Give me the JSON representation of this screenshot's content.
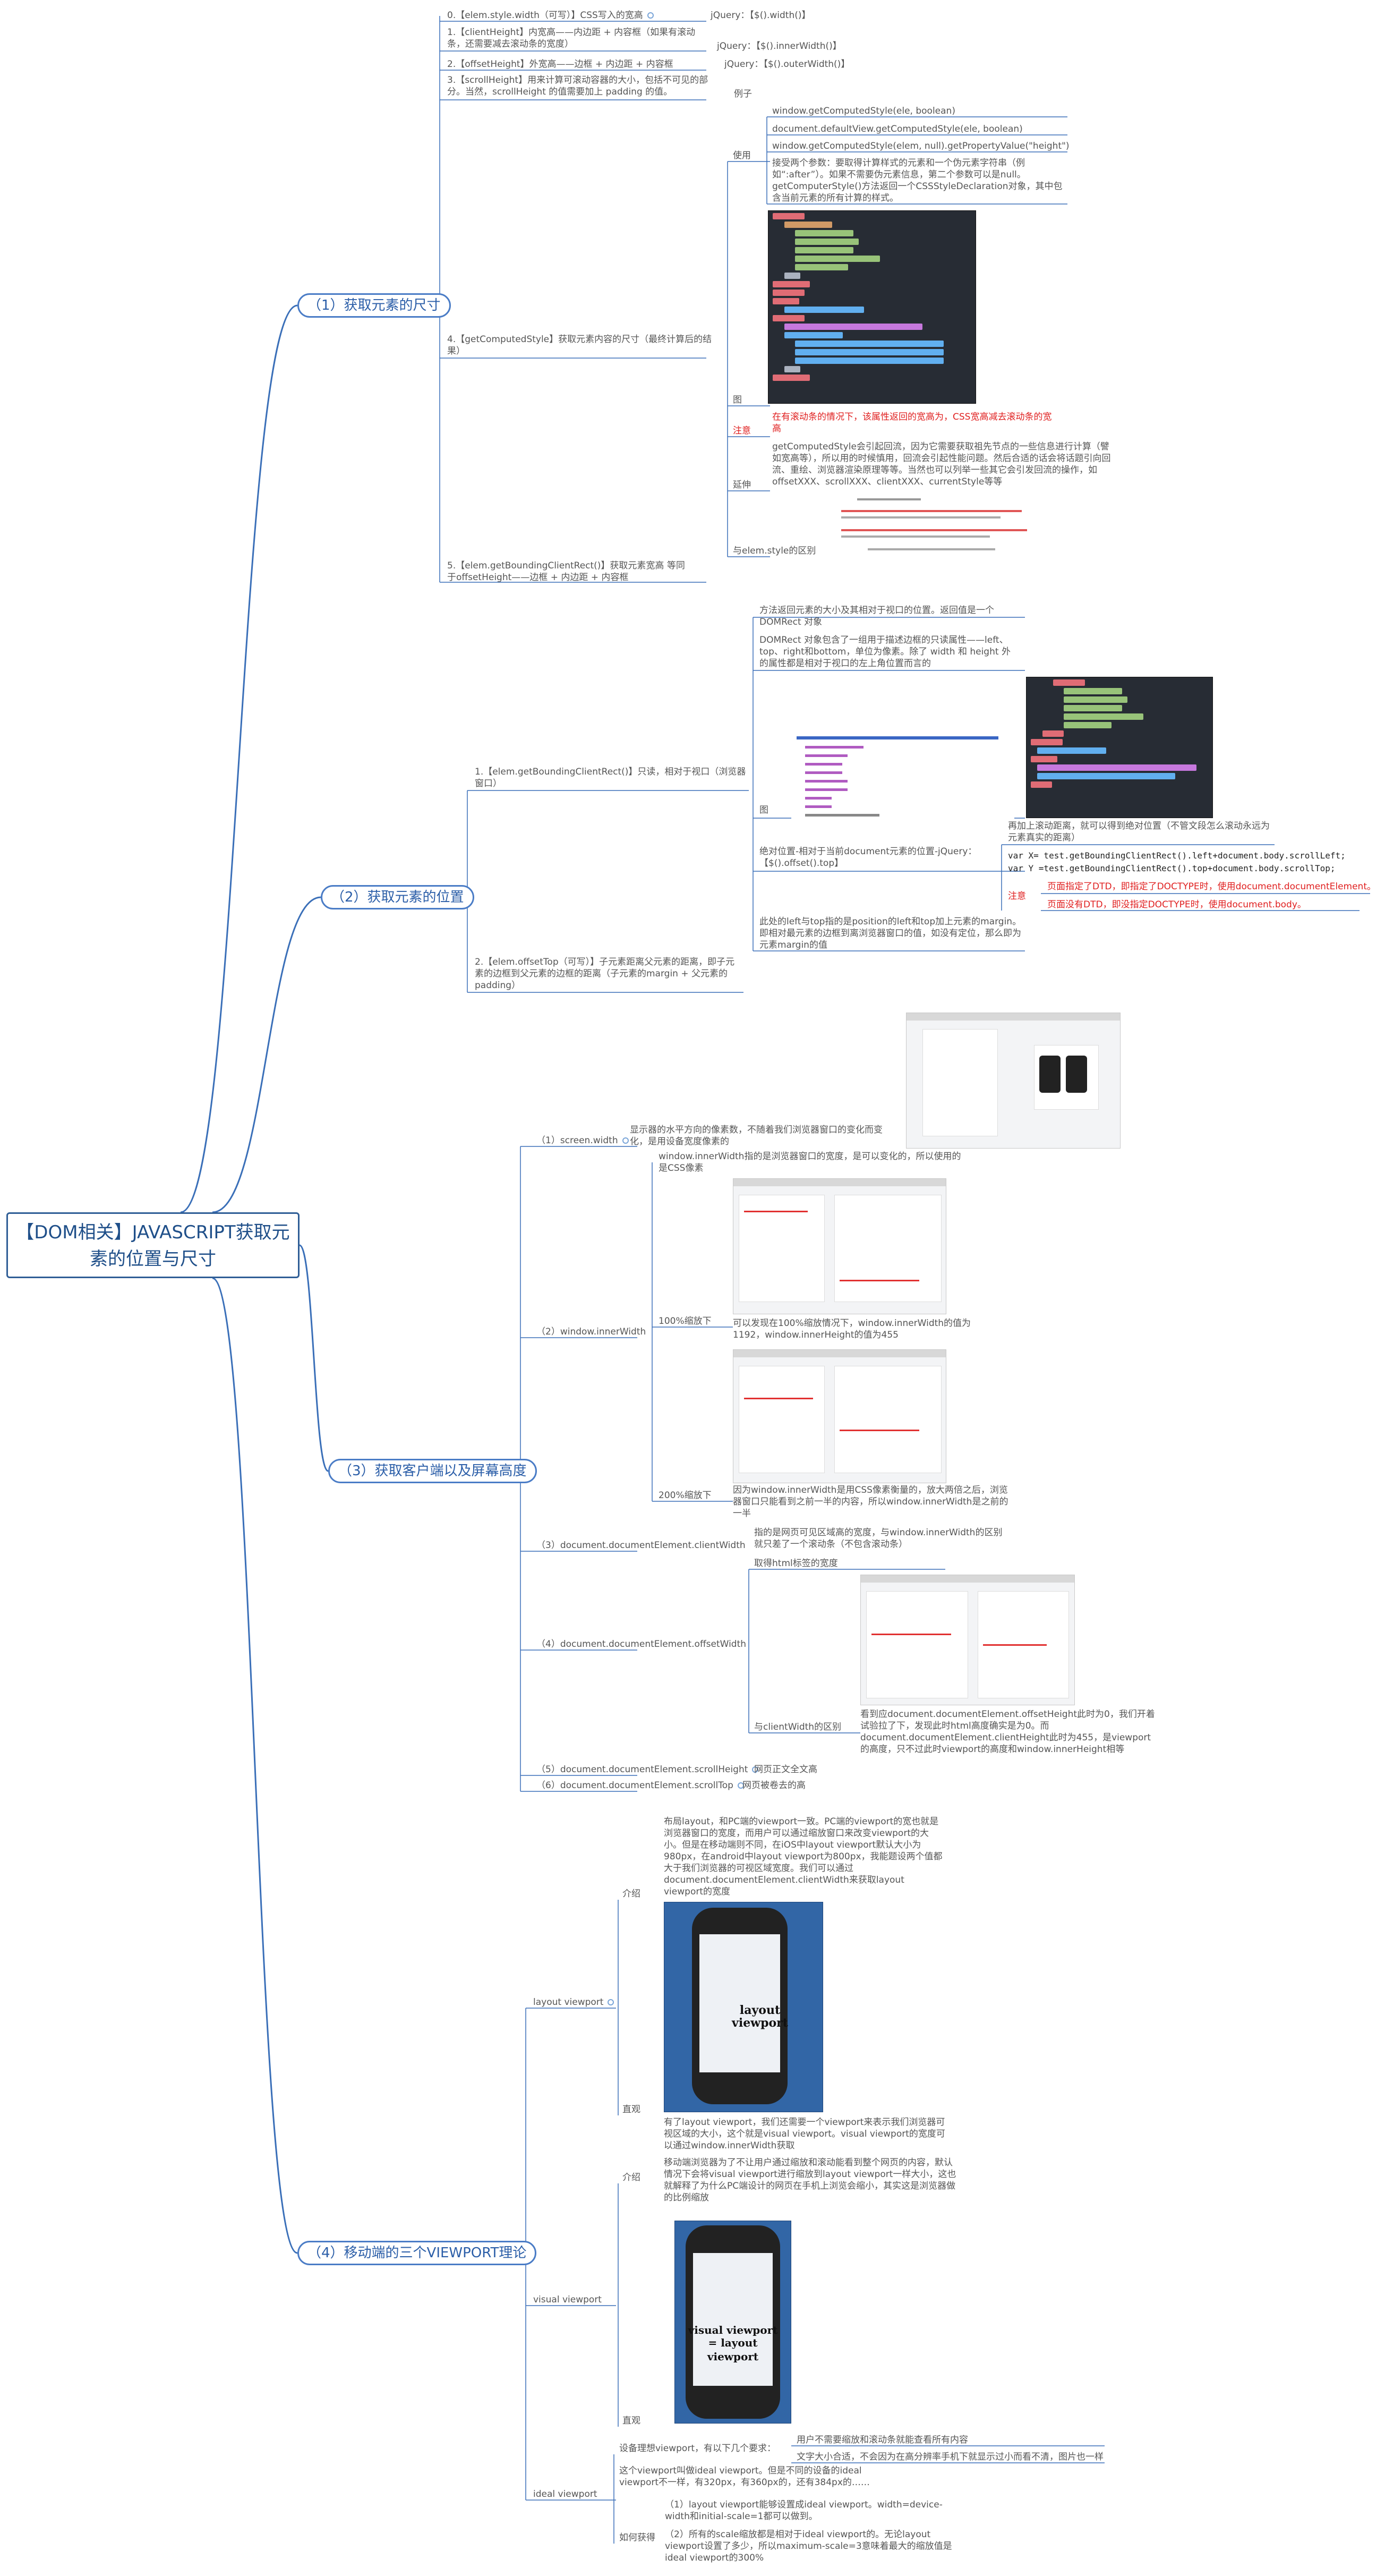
{
  "root": {
    "title": "【DOM相关】JAVASCRIPT获取元素的位置与尺寸"
  },
  "branches": {
    "b1": "（1）获取元素的尺寸",
    "b2": "（2）获取元素的位置",
    "b3": "（3）获取客户端以及屏幕高度",
    "b4": "（4）移动端的三个VIEWPORT理论"
  },
  "n1": {
    "elem_style": "0.【elem.style.width（可写）】CSS写入的宽高",
    "elem_style_jq": "jQuery：【$().width()】",
    "client": "1.【clientHeight】内宽高——内边距 + 内容框（如果有滚动条，还需要减去滚动条的宽度）",
    "client_jq": "jQuery：【$().innerWidth()】",
    "offset": "2.【offsetHeight】外宽高——边框 + 内边距 + 内容框",
    "offset_jq": "jQuery：【$().outerWidth()】",
    "scroll": "3.【scrollHeight】用来计算可滚动容器的大小，包括不可见的部分。当然，scrollHeight 的值需要加上 padding 的值。",
    "scroll_ex": "例子",
    "gcs": "4.【getComputedStyle】获取元素内容的尺寸（最终计算后的结果）",
    "usage": "使用",
    "u1": "window.getComputedStyle(ele, boolean)",
    "u2": "document.defaultView.getComputedStyle(ele, boolean)",
    "u3": "window.getComputedStyle(elem, null).getPropertyValue(\"height\")",
    "u_desc": "接受两个参数：要取得计算样式的元素和一个伪元素字符串（例如“:after”）。如果不需要伪元素信息，第二个参数可以是null。getComputerStyle()方法返回一个CSSStyleDeclaration对象，其中包含当前元素的所有计算的样式。",
    "pic": "图",
    "note": "注意",
    "note_text": "在有滚动条的情况下，该属性返回的宽高为，CSS宽高减去滚动条的宽高",
    "compat": "延伸",
    "compat_text": "getComputedStyle会引起回流，因为它需要获取祖先节点的一些信息进行计算（譬如宽高等），所以用的时候慎用，回流会引起性能问题。然后合适的话会将话题引向回流、重绘、浏览器渲染原理等等。当然也可以列举一些其它会引发回流的操作，如offsetXXX、scrollXXX、clientXXX、currentStyle等等",
    "diff": "与elem.style的区别",
    "gbcr": "5.【elem.getBoundingClientRect()】获取元素宽高 等同于offsetHeight——边框 + 内边距 + 内容框"
  },
  "n2": {
    "gbcr": "1.【elem.getBoundingClientRect()】只读，相对于视口（浏览器窗口）",
    "desc1": "方法返回元素的大小及其相对于视口的位置。返回值是一个 DOMRect 对象",
    "desc2": "DOMRect 对象包含了一组用于描述边框的只读属性——left、top、right和bottom，单位为像素。除了 width 和 height 外的属性都是相对于视口的左上角位置而言的",
    "pic": "图",
    "abs": "绝对位置-相对于当前document元素的位置-jQuery：【$().offset().top】",
    "abs_desc": "再加上滚动距离，就可以得到绝对位置（不管文段怎么滚动永远为元素真实的距离）",
    "code1": "var X= test.getBoundingClientRect().left+document.body.scrollLeft;",
    "code2": "var Y =test.getBoundingClientRect().top+document.body.scrollTop;",
    "note": "注意",
    "note1": "页面指定了DTD，即指定了DOCTYPE时，使用document.documentElement。",
    "note2": "页面没有DTD，即没指定DOCTYPE时，使用document.body。",
    "ext": "此处的left与top指的是position的left和top加上元素的margin。即相对最元素的边框到离浏览器窗口的值，如没有定位，那么即为元素margin的值",
    "offsettop": "2.【elem.offsetTop（可写）】子元素距离父元素的距离，即子元素的边框到父元素的边框的距离（子元素的margin + 父元素的padding）"
  },
  "n3": {
    "sw": "（1）screen.width",
    "sw_desc": "显示器的水平方向的像素数，不随着我们浏览器窗口的变化而变化，是用设备宽度像素的",
    "iw": "（2）window.innerWidth",
    "iw_desc": "window.innerWidth指的是浏览器窗口的宽度，是可以变化的，所以使用的是CSS像素",
    "zoom100": "100%缩放下",
    "zoom100_desc": "可以发现在100%缩放情况下，window.innerWidth的值为1192，window.innerHeight的值为455",
    "zoom200": "200%缩放下",
    "zoom200_desc": "因为window.innerWidth是用CSS像素衡量的，放大两倍之后，浏览器窗口只能看到之前一半的内容，所以window.innerWidth是之前的一半",
    "cw": "（3）document.documentElement.clientWidth",
    "cw_desc": "指的是网页可见区域高的宽度，与window.innerWidth的区别就只差了一个滚动条（不包含滚动条）",
    "ow": "（4）document.documentElement.offsetWidth",
    "ow_desc": "取得html标签的宽度",
    "ow_diff": "与clientWidth的区别",
    "ow_diff_desc": "看到应document.documentElement.offsetHeight此时为0，我们开着试验拉了下，发现此时html高度确实是为0。而document.documentElement.clientHeight此时为455，是viewport的高度，只不过此时viewport的高度和window.innerHeight相等",
    "sh": "（5）document.documentElement.scrollHeight",
    "sh_desc": "网页正文全文高",
    "st": "（6）document.documentElement.scrollTop",
    "st_desc": "网页被卷去的高"
  },
  "n4": {
    "layout": "layout viewport",
    "intro": "介绍",
    "layout_desc": "布局layout，和PC端的viewport一致。PC端的viewport的宽也就是浏览器窗口的宽度，而用户可以通过缩放窗口来改变viewport的大小。但是在移动端则不同，在iOS中layout viewport默认大小为980px，在android中layout viewport为800px，我能题设两个值都大于我们浏览器的可视区域宽度。我们可以通过document.documentElement.clientWidth来获取layout viewport的宽度",
    "illus": "直观",
    "layout_cap1": "layout",
    "layout_cap2": "viewport",
    "visual": "visual viewport",
    "visual_desc1": "有了layout viewport，我们还需要一个viewport来表示我们浏览器可视区域的大小，这个就是visual viewport。visual viewport的宽度可以通过window.innerWidth获取",
    "visual_desc2": "移动端浏览器为了不让用户通过缩放和滚动能看到整个网页的内容，默认情况下会将visual viewport进行缩放到layout viewport一样大小，这也就解释了为什么PC端设计的网页在手机上浏览会缩小，其实这是浏览器做的比例缩放",
    "visual_cap1": "visual viewport",
    "visual_cap2": "= layout viewport",
    "ideal": "ideal viewport",
    "ideal_need": "设备理想viewport，有以下几个要求：",
    "need1": "用户不需要缩放和滚动条就能查看所有内容",
    "need2": "文字大小合适，不会因为在高分辨率手机下就显示过小而看不清，图片也一样",
    "ideal_desc": "这个viewport叫做ideal viewport。但是不同的设备的ideal viewport不一样，有320px，有360px的，还有384px的……",
    "howto": "如何获得",
    "how1": "（1）layout viewport能够设置成ideal viewport。width=device-width和initial-scale=1都可以做到。",
    "how2": "（2）所有的scale缩放都是相对于ideal viewport的。无论layout viewport设置了多少，所以maximum-scale=3意味着最大的缩放值是ideal viewport的300%"
  },
  "colors": {
    "line": "#3a6fb8",
    "branch_text": "#2b5ea8",
    "red": "#e02020",
    "code_bg": "#272c34"
  }
}
